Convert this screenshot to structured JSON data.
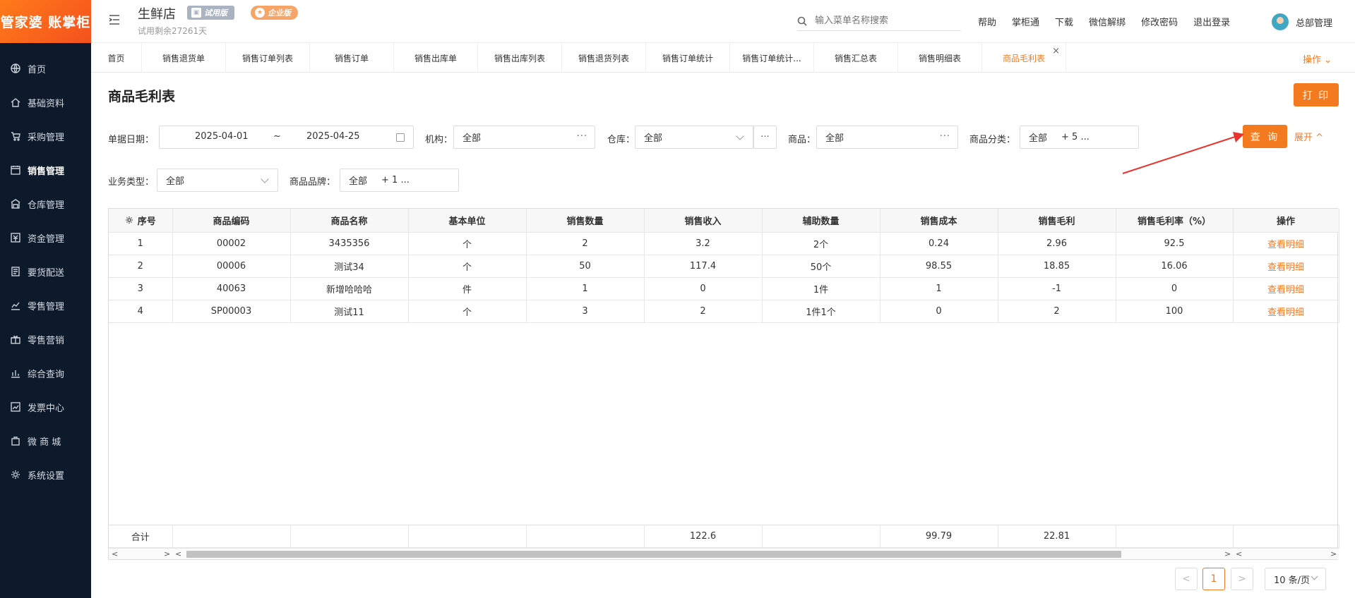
{
  "app": {
    "logo_text": "管家婆 账掌柜",
    "store_name": "生鲜店",
    "trial_badge": "试用版",
    "enterprise_badge": "企业版",
    "trial_remaining": "试用剩余27261天"
  },
  "sidebar": {
    "items": [
      {
        "label": "首页",
        "icon": "globe-icon"
      },
      {
        "label": "基础资料",
        "icon": "home-icon"
      },
      {
        "label": "采购管理",
        "icon": "cart-icon"
      },
      {
        "label": "销售管理",
        "icon": "calendar-icon",
        "active": true
      },
      {
        "label": "仓库管理",
        "icon": "warehouse-icon"
      },
      {
        "label": "资金管理",
        "icon": "money-icon"
      },
      {
        "label": "要货配送",
        "icon": "list-icon"
      },
      {
        "label": "零售管理",
        "icon": "chart-icon"
      },
      {
        "label": "零售营销",
        "icon": "gift-icon"
      },
      {
        "label": "综合查询",
        "icon": "bar-chart-icon"
      },
      {
        "label": "发票中心",
        "icon": "trend-icon"
      },
      {
        "label": "微 商 城",
        "icon": "bag-icon"
      },
      {
        "label": "系统设置",
        "icon": "gear-icon"
      }
    ]
  },
  "header": {
    "search_placeholder": "输入菜单名称搜索",
    "links": [
      "帮助",
      "掌柜通",
      "下载",
      "微信解绑",
      "修改密码",
      "退出登录"
    ],
    "user_name": "总部管理"
  },
  "tabs": {
    "items": [
      "首页",
      "销售退货单",
      "销售订单列表",
      "销售订单",
      "销售出库单",
      "销售出库列表",
      "销售退货列表",
      "销售订单统计",
      "销售订单统计...",
      "销售汇总表",
      "销售明细表",
      "商品毛利表"
    ],
    "active_index": 11,
    "close_glyph": "×",
    "operations_label": "操作 ⌄"
  },
  "page": {
    "title": "商品毛利表",
    "print_label": "打 印"
  },
  "filters": {
    "date_label": "单据日期",
    "date_start": "2025-04-01",
    "date_sep": "~",
    "date_end": "2025-04-25",
    "org_label": "机构",
    "org_value": "全部",
    "warehouse_label": "仓库",
    "warehouse_value": "全部",
    "product_label": "商品",
    "product_value": "全部",
    "category_label": "商品分类",
    "category_value": "全部",
    "category_more": "+ 5 ...",
    "biz_type_label": "业务类型",
    "biz_type_value": "全部",
    "brand_label": "商品品牌",
    "brand_value": "全部",
    "brand_more": "+ 1 ...",
    "more_glyph": "···",
    "query_label": "查 询",
    "expand_label": "展开 ^"
  },
  "table": {
    "columns": [
      "序号",
      "商品编码",
      "商品名称",
      "基本单位",
      "销售数量",
      "销售收入",
      "辅助数量",
      "销售成本",
      "销售毛利",
      "销售毛利率（%）",
      "操作"
    ],
    "rows": [
      [
        "1",
        "00002",
        "3435356",
        "个",
        "2",
        "3.2",
        "2个",
        "0.24",
        "2.96",
        "92.5",
        "查看明细"
      ],
      [
        "2",
        "00006",
        "测试34",
        "个",
        "50",
        "117.4",
        "50个",
        "98.55",
        "18.85",
        "16.06",
        "查看明细"
      ],
      [
        "3",
        "40063",
        "新增哈哈哈",
        "件",
        "1",
        "0",
        "1件",
        "1",
        "-1",
        "0",
        "查看明细"
      ],
      [
        "4",
        "SP00003",
        "测试11",
        "个",
        "3",
        "2",
        "1件1个",
        "0",
        "2",
        "100",
        "查看明细"
      ]
    ],
    "total": [
      "合计",
      "",
      "",
      "",
      "",
      "122.6",
      "",
      "99.79",
      "22.81",
      "",
      ""
    ]
  },
  "pagination": {
    "prev": "<",
    "current_page": "1",
    "next": ">",
    "page_size": "10 条/页"
  },
  "colors": {
    "accent": "#f47a20",
    "sidebar_bg": "#0d1a2b",
    "arrow": "#e8342f"
  }
}
